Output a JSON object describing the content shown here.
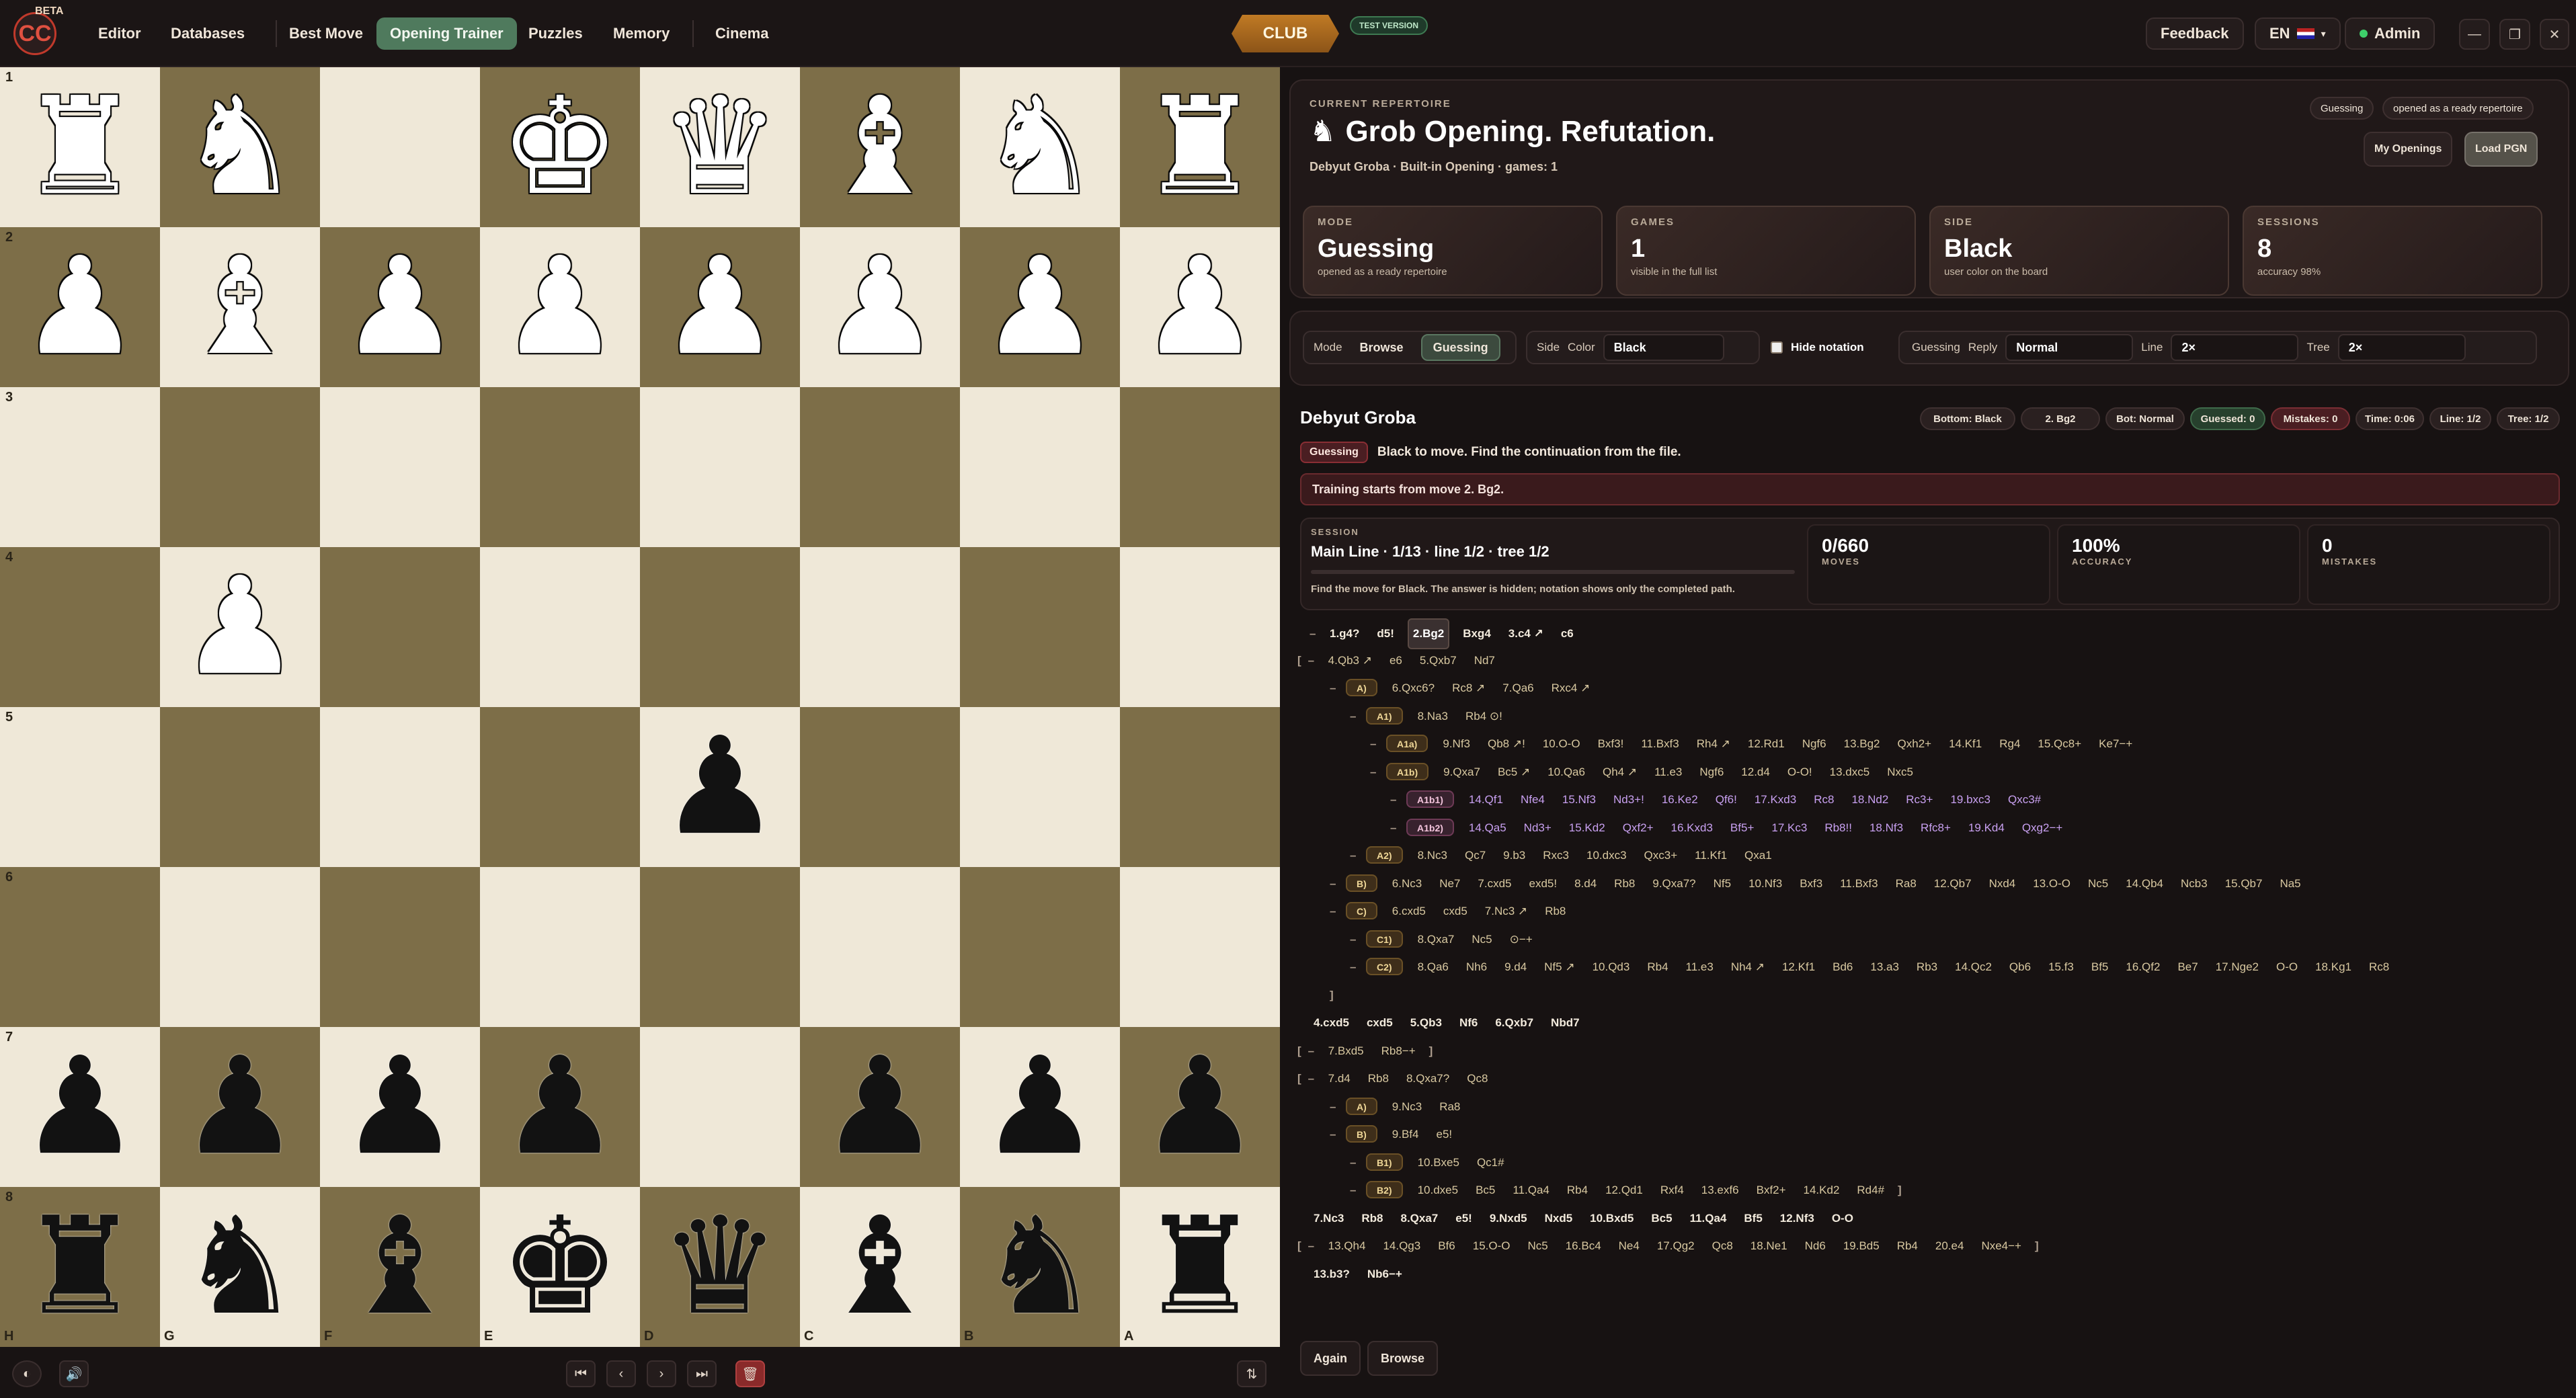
{
  "app": {
    "logo_text": "CC",
    "beta": "BETA"
  },
  "nav": {
    "items": [
      "Editor",
      "Databases",
      "Best Move",
      "Opening Trainer",
      "Puzzles",
      "Memory",
      "Cinema"
    ],
    "active": "Opening Trainer",
    "club": "CLUB",
    "test_version": "TEST VERSION",
    "feedback": "Feedback",
    "lang": "EN",
    "user": "Admin"
  },
  "colors": {
    "accent_green": "#4f7a5d",
    "club_gold": "#c07a24",
    "danger_red": "#4a1e22",
    "board_light": "#efe8d8",
    "board_dark": "#7d6e48"
  },
  "board": {
    "ranks": [
      "1",
      "2",
      "3",
      "4",
      "5",
      "6",
      "7",
      "8"
    ],
    "files": [
      "H",
      "G",
      "F",
      "E",
      "D",
      "C",
      "B",
      "A"
    ],
    "rows": [
      [
        "wR",
        "wN",
        "",
        "wK",
        "wQ",
        "wB",
        "wN",
        "wR"
      ],
      [
        "wP",
        "wB",
        "wP",
        "wP",
        "wP",
        "wP",
        "wP",
        "wP"
      ],
      [
        "",
        "",
        "",
        "",
        "",
        "",
        "",
        ""
      ],
      [
        "",
        "wP",
        "",
        "",
        "",
        "",
        "",
        ""
      ],
      [
        "",
        "",
        "",
        "",
        "bP",
        "",
        "",
        ""
      ],
      [
        "",
        "",
        "",
        "",
        "",
        "",
        "",
        ""
      ],
      [
        "bP",
        "bP",
        "bP",
        "bP",
        "",
        "bP",
        "bP",
        "bP"
      ],
      [
        "bR",
        "bN",
        "bB",
        "bK",
        "bQ",
        "bB",
        "bN",
        "bR"
      ]
    ]
  },
  "header": {
    "eyebrow": "CURRENT REPERTOIRE",
    "title": "Grob Opening. Refutation.",
    "subtitle": "Debyut Groba · Built-in Opening · games: 1",
    "badge1": "Guessing",
    "badge2": "opened as a ready repertoire",
    "my_openings": "My Openings",
    "load_pgn": "Load PGN"
  },
  "stats": [
    {
      "label": "MODE",
      "value": "Guessing",
      "sub": "opened as a ready repertoire"
    },
    {
      "label": "GAMES",
      "value": "1",
      "sub": "visible in the full list"
    },
    {
      "label": "SIDE",
      "value": "Black",
      "sub": "user color on the board"
    },
    {
      "label": "SESSIONS",
      "value": "8",
      "sub": "accuracy 98%"
    }
  ],
  "controls": {
    "mode_label": "Mode",
    "browse": "Browse",
    "guessing": "Guessing",
    "side_label": "Side",
    "color_label": "Color",
    "color_value": "Black",
    "hide_notation": "Hide notation",
    "guessing_label": "Guessing",
    "reply_label": "Reply",
    "reply_value": "Normal",
    "line_label": "Line",
    "line_value": "2×",
    "tree_label": "Tree",
    "tree_value": "2×"
  },
  "game": {
    "title": "Debyut Groba",
    "pills": [
      "Bottom: Black",
      "2. Bg2",
      "Bot: Normal",
      "Guessed: 0",
      "Mistakes: 0",
      "Time: 0:06",
      "Line: 1/2",
      "Tree: 1/2"
    ],
    "guess_tag": "Guessing",
    "instruction": "Black to move. Find the continuation from the file.",
    "training_start": "Training starts from move 2. Bg2."
  },
  "session": {
    "label": "SESSION",
    "line": "Main Line · 1/13 · line 1/2 · tree 1/2",
    "hint": "Find the move for Black. The answer is hidden; notation shows only the completed path.",
    "moves_value": "0/660",
    "moves_label": "MOVES",
    "accuracy_value": "100%",
    "accuracy_label": "ACCURACY",
    "mistakes_value": "0",
    "mistakes_label": "MISTAKES"
  },
  "notation": [
    {
      "indent": 0,
      "minus": true,
      "moves": [
        "1.g4?",
        "d5!",
        "2.Bg2",
        "Bxg4",
        "3.c4 ↗",
        "c6"
      ],
      "style": "main",
      "cur": 2
    },
    {
      "indent": 0,
      "open": "[",
      "minus": true,
      "moves": [
        "4.Qb3 ↗",
        "e6",
        "5.Qxb7",
        "Nd7"
      ]
    },
    {
      "indent": 1,
      "minus": true,
      "tag": "A)",
      "moves": [
        "6.Qxc6?",
        "Rc8 ↗",
        "7.Qa6",
        "Rxc4 ↗"
      ]
    },
    {
      "indent": 2,
      "minus": true,
      "tag": "A1)",
      "moves": [
        "8.Na3",
        "Rb4 ⊙!"
      ]
    },
    {
      "indent": 3,
      "minus": true,
      "tag": "A1a)",
      "moves": [
        "9.Nf3",
        "Qb8 ↗!",
        "10.O-O",
        "Bxf3!",
        "11.Bxf3",
        "Rh4 ↗",
        "12.Rd1",
        "Ngf6",
        "13.Bg2",
        "Qxh2+",
        "14.Kf1",
        "Rg4",
        "15.Qc8+",
        "Ke7−+"
      ]
    },
    {
      "indent": 3,
      "minus": true,
      "tag": "A1b)",
      "moves": [
        "9.Qxa7",
        "Bc5 ↗",
        "10.Qa6",
        "Qh4 ↗",
        "11.e3",
        "Ngf6",
        "12.d4",
        "O-O!",
        "13.dxc5",
        "Nxc5"
      ]
    },
    {
      "indent": 4,
      "minus": true,
      "tag": "A1b1)",
      "deep": true,
      "moves": [
        "14.Qf1",
        "Nfe4",
        "15.Nf3",
        "Nd3+!",
        "16.Ke2",
        "Qf6!",
        "17.Kxd3",
        "Rc8",
        "18.Nd2",
        "Rc3+",
        "19.bxc3",
        "Qxc3#"
      ]
    },
    {
      "indent": 4,
      "minus": true,
      "tag": "A1b2)",
      "deep": true,
      "moves": [
        "14.Qa5",
        "Nd3+",
        "15.Kd2",
        "Qxf2+",
        "16.Kxd3",
        "Bf5+",
        "17.Kc3",
        "Rb8!!",
        "18.Nf3",
        "Rfc8+",
        "19.Kd4",
        "Qxg2−+"
      ]
    },
    {
      "indent": 2,
      "minus": true,
      "tag": "A2)",
      "moves": [
        "8.Nc3",
        "Qc7",
        "9.b3",
        "Rxc3",
        "10.dxc3",
        "Qxc3+",
        "11.Kf1",
        "Qxa1"
      ]
    },
    {
      "indent": 1,
      "minus": true,
      "tag": "B)",
      "moves": [
        "6.Nc3",
        "Ne7",
        "7.cxd5",
        "exd5!",
        "8.d4",
        "Rb8",
        "9.Qxa7?",
        "Nf5",
        "10.Nf3",
        "Bxf3",
        "11.Bxf3",
        "Ra8",
        "12.Qb7",
        "Nxd4",
        "13.O-O",
        "Nc5",
        "14.Qb4",
        "Ncb3",
        "15.Qb7",
        "Na5"
      ]
    },
    {
      "indent": 1,
      "minus": true,
      "tag": "C)",
      "moves": [
        "6.cxd5",
        "cxd5",
        "7.Nc3 ↗",
        "Rb8"
      ]
    },
    {
      "indent": 2,
      "minus": true,
      "tag": "C1)",
      "moves": [
        "8.Qxa7",
        "Nc5",
        "⊙−+"
      ]
    },
    {
      "indent": 2,
      "minus": true,
      "tag": "C2)",
      "moves": [
        "8.Qa6",
        "Nh6",
        "9.d4",
        "Nf5 ↗",
        "10.Qd3",
        "Rb4",
        "11.e3",
        "Nh4 ↗",
        "12.Kf1",
        "Bd6",
        "13.a3",
        "Rb3",
        "14.Qc2",
        "Qb6",
        "15.f3",
        "Bf5",
        "16.Qf2",
        "Be7",
        "17.Nge2",
        "O-O",
        "18.Kg1",
        "Rc8"
      ]
    },
    {
      "indent": 1,
      "close": "]",
      "moves": []
    },
    {
      "indent": 0,
      "style": "main",
      "moves": [
        "4.cxd5",
        "cxd5",
        "5.Qb3",
        "Nf6",
        "6.Qxb7",
        "Nbd7"
      ]
    },
    {
      "indent": 0,
      "open": "[",
      "minus": true,
      "moves": [
        "7.Bxd5",
        "Rb8−+"
      ],
      "close": "]"
    },
    {
      "indent": 0,
      "open": "[",
      "minus": true,
      "moves": [
        "7.d4",
        "Rb8",
        "8.Qxa7?",
        "Qc8"
      ]
    },
    {
      "indent": 1,
      "minus": true,
      "tag": "A)",
      "moves": [
        "9.Nc3",
        "Ra8"
      ]
    },
    {
      "indent": 1,
      "minus": true,
      "tag": "B)",
      "moves": [
        "9.Bf4",
        "e5!"
      ]
    },
    {
      "indent": 2,
      "minus": true,
      "tag": "B1)",
      "moves": [
        "10.Bxe5",
        "Qc1#"
      ]
    },
    {
      "indent": 2,
      "minus": true,
      "tag": "B2)",
      "moves": [
        "10.dxe5",
        "Bc5",
        "11.Qa4",
        "Rb4",
        "12.Qd1",
        "Rxf4",
        "13.exf6",
        "Bxf2+",
        "14.Kd2",
        "Rd4#"
      ],
      "close": "]"
    },
    {
      "indent": 0,
      "style": "main",
      "moves": [
        "7.Nc3",
        "Rb8",
        "8.Qxa7",
        "e5!",
        "9.Nxd5",
        "Nxd5",
        "10.Bxd5",
        "Bc5",
        "11.Qa4",
        "Bf5",
        "12.Nf3",
        "O-O"
      ]
    },
    {
      "indent": 0,
      "open": "[",
      "minus": true,
      "moves": [
        "13.Qh4",
        "14.Qg3",
        "Bf6",
        "15.O-O",
        "Nc5",
        "16.Bc4",
        "Ne4",
        "17.Qg2",
        "Qc8",
        "18.Ne1",
        "Nd6",
        "19.Bd5",
        "Rb4",
        "20.e4",
        "Nxe4−+"
      ],
      "close": "]"
    },
    {
      "indent": 0,
      "style": "main",
      "moves": [
        "13.b3?",
        "Nb6−+"
      ]
    }
  ],
  "actions": {
    "again": "Again",
    "browse": "Browse"
  }
}
